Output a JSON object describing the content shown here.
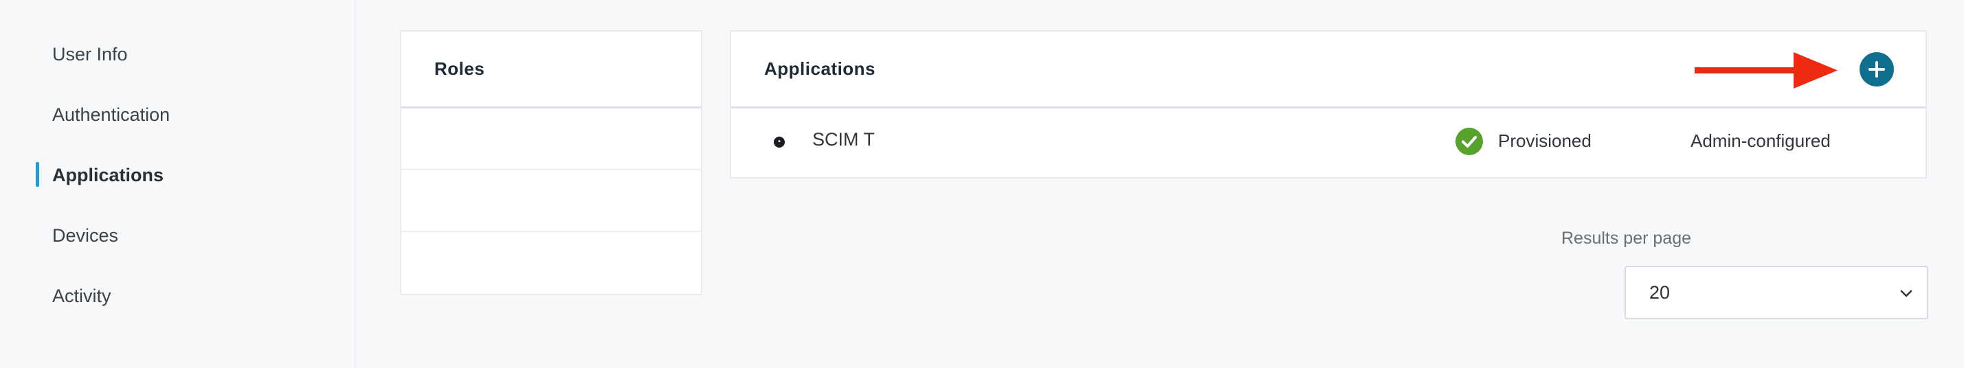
{
  "sidebar": {
    "items": [
      {
        "label": "User Info",
        "active": false
      },
      {
        "label": "Authentication",
        "active": false
      },
      {
        "label": "Applications",
        "active": true
      },
      {
        "label": "Devices",
        "active": false
      },
      {
        "label": "Activity",
        "active": false
      }
    ]
  },
  "roles": {
    "title": "Roles"
  },
  "applications": {
    "title": "Applications",
    "add_icon": "plus-icon",
    "rows": [
      {
        "name": "SCIM T",
        "status": "Provisioned",
        "status_icon": "check-circle-icon",
        "configuration": "Admin-configured"
      }
    ]
  },
  "pagination": {
    "results_label": "Results per page",
    "per_page": "20"
  },
  "colors": {
    "accent": "#1f9bd0",
    "add_button": "#0f6f8f",
    "status_ok": "#57a22d",
    "annotation_arrow": "#ee2a13"
  }
}
